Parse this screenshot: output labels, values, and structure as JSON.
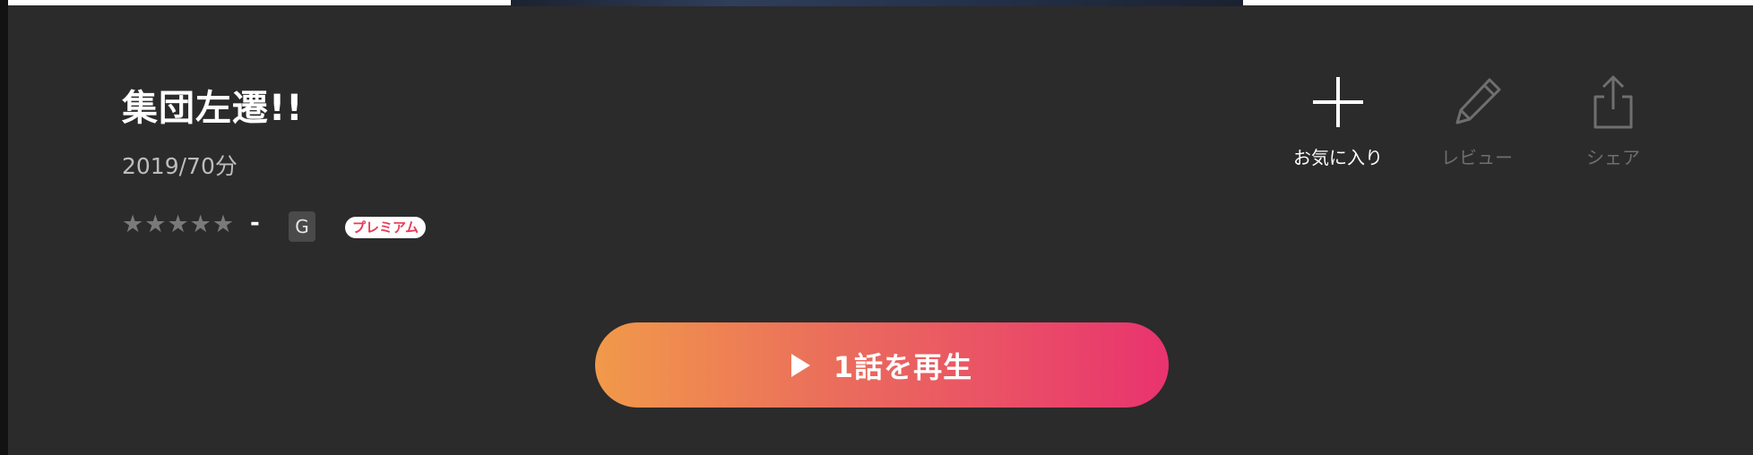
{
  "title": "集団左遷!!",
  "meta": "2019/70分",
  "rating": {
    "stars_filled": 0,
    "stars_total": 5,
    "value": "-"
  },
  "age_rating": "G",
  "premium_badge": "プレミアム",
  "actions": {
    "favorite_label": "お気に入り",
    "review_label": "レビュー",
    "share_label": "シェア"
  },
  "play_button": {
    "label": "1話を再生"
  },
  "colors": {
    "background": "#2b2b2b",
    "premium_text": "#e83a55",
    "play_gradient_start": "#f1994a",
    "play_gradient_end": "#e9336f",
    "inactive": "#6f6f6f"
  },
  "icons": [
    "plus-icon",
    "pencil-icon",
    "share-icon",
    "play-icon",
    "star-icon"
  ]
}
